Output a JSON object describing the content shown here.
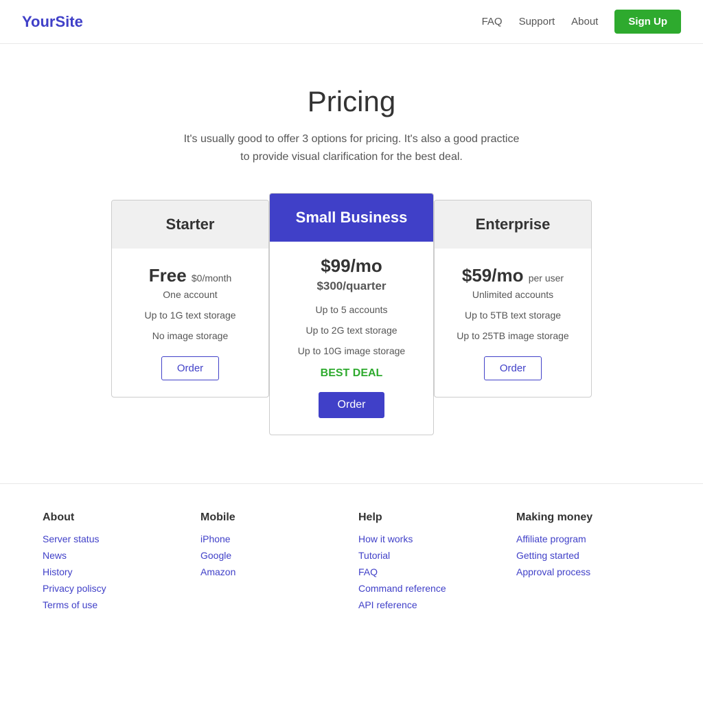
{
  "header": {
    "logo": "YourSite",
    "nav": {
      "faq": "FAQ",
      "support": "Support",
      "about": "About",
      "signup": "Sign Up"
    }
  },
  "pricing": {
    "title": "Pricing",
    "subtitle": "It's usually good to offer 3 options for pricing. It's also a good practice to provide visual clarification for the best deal.",
    "cards": [
      {
        "id": "starter",
        "name": "Starter",
        "highlighted": false,
        "price_main": "Free",
        "price_suffix": "$0/month",
        "price_alt": "",
        "features": [
          "One account",
          "Up to 1G text storage",
          "No image storage"
        ],
        "best_deal": false,
        "order_label": "Order"
      },
      {
        "id": "small-business",
        "name": "Small Business",
        "highlighted": true,
        "price_main": "$99/mo",
        "price_suffix": "",
        "price_alt": "$300/quarter",
        "features": [
          "Up to 5 accounts",
          "Up to 2G text storage",
          "Up to 10G image storage"
        ],
        "best_deal": true,
        "best_deal_label": "BEST DEAL",
        "order_label": "Order"
      },
      {
        "id": "enterprise",
        "name": "Enterprise",
        "highlighted": false,
        "price_main": "$59/mo",
        "price_suffix": "per user",
        "price_alt": "",
        "features": [
          "Unlimited accounts",
          "Up to 5TB text storage",
          "Up to 25TB image storage"
        ],
        "best_deal": false,
        "order_label": "Order"
      }
    ]
  },
  "footer": {
    "columns": [
      {
        "title": "About",
        "links": [
          "Server status",
          "News",
          "History",
          "Privacy poliscy",
          "Terms of use"
        ]
      },
      {
        "title": "Mobile",
        "links": [
          "iPhone",
          "Google",
          "Amazon"
        ]
      },
      {
        "title": "Help",
        "links": [
          "How it works",
          "Tutorial",
          "FAQ",
          "Command reference",
          "API reference"
        ]
      },
      {
        "title": "Making money",
        "links": [
          "Affiliate program",
          "Getting started",
          "Approval process"
        ]
      }
    ]
  }
}
